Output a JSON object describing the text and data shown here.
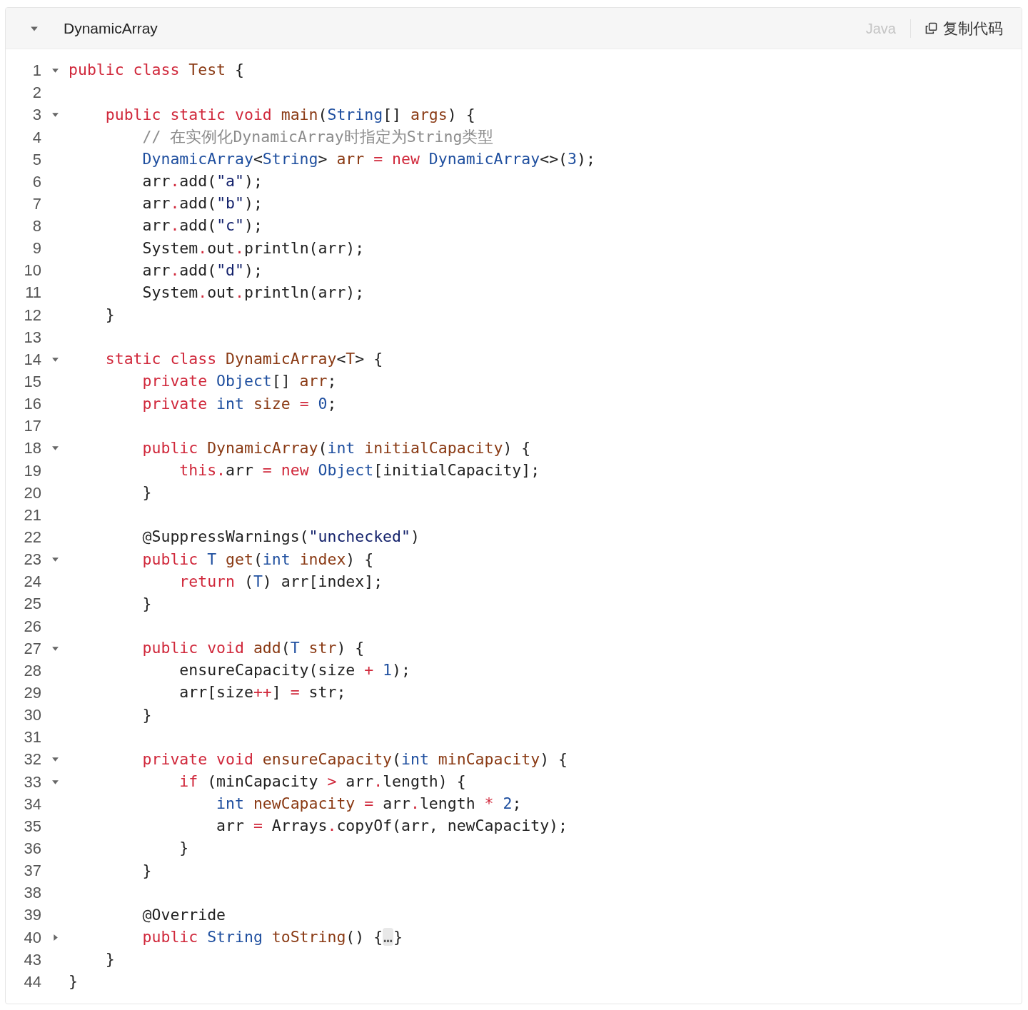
{
  "code_block": {
    "title": "DynamicArray",
    "expanded": true,
    "language": "Java",
    "copy_button": "复制代码",
    "lines": [
      {
        "number": "1",
        "expanded": true,
        "tokens": [
          {
            "kind": "kw",
            "text": "public class"
          },
          {
            "kind": "def",
            "text": " Test"
          },
          {
            "kind": "p",
            "text": " {"
          }
        ]
      },
      {
        "number": "2"
      },
      {
        "number": "3",
        "expanded": true,
        "tokens": [
          {
            "kind": "kw",
            "text": "    public static void"
          },
          {
            "kind": "def",
            "text": " main"
          },
          {
            "kind": "p",
            "text": "("
          },
          {
            "kind": "type",
            "text": "String"
          },
          {
            "kind": "p",
            "text": "[]"
          },
          {
            "kind": "def",
            "text": " args"
          },
          {
            "kind": "p",
            "text": ") {"
          }
        ]
      },
      {
        "number": "4",
        "tokens": [
          {
            "kind": "cm",
            "text": "        // 在实例化DynamicArray时指定为String类型"
          }
        ]
      },
      {
        "number": "5",
        "tokens": [
          {
            "kind": "type",
            "text": "        DynamicArray"
          },
          {
            "kind": "p",
            "text": "<"
          },
          {
            "kind": "type",
            "text": "String"
          },
          {
            "kind": "p",
            "text": ">"
          },
          {
            "kind": "def",
            "text": " arr"
          },
          {
            "kind": "op",
            "text": " ="
          },
          {
            "kind": "kw",
            "text": " new"
          },
          {
            "kind": "type",
            "text": " DynamicArray"
          },
          {
            "kind": "p",
            "text": "<>("
          },
          {
            "kind": "num",
            "text": "3"
          },
          {
            "kind": "p",
            "text": ");"
          }
        ]
      },
      {
        "number": "6",
        "tokens": [
          {
            "kind": "p",
            "text": "        arr"
          },
          {
            "kind": "op",
            "text": "."
          },
          {
            "kind": "p",
            "text": "add("
          },
          {
            "kind": "str",
            "text": "\"a\""
          },
          {
            "kind": "p",
            "text": ");"
          }
        ]
      },
      {
        "number": "7",
        "tokens": [
          {
            "kind": "p",
            "text": "        arr"
          },
          {
            "kind": "op",
            "text": "."
          },
          {
            "kind": "p",
            "text": "add("
          },
          {
            "kind": "str",
            "text": "\"b\""
          },
          {
            "kind": "p",
            "text": ");"
          }
        ]
      },
      {
        "number": "8",
        "tokens": [
          {
            "kind": "p",
            "text": "        arr"
          },
          {
            "kind": "op",
            "text": "."
          },
          {
            "kind": "p",
            "text": "add("
          },
          {
            "kind": "str",
            "text": "\"c\""
          },
          {
            "kind": "p",
            "text": ");"
          }
        ]
      },
      {
        "number": "9",
        "tokens": [
          {
            "kind": "p",
            "text": "        System"
          },
          {
            "kind": "op",
            "text": "."
          },
          {
            "kind": "p",
            "text": "out"
          },
          {
            "kind": "op",
            "text": "."
          },
          {
            "kind": "p",
            "text": "println(arr);"
          }
        ]
      },
      {
        "number": "10",
        "tokens": [
          {
            "kind": "p",
            "text": "        arr"
          },
          {
            "kind": "op",
            "text": "."
          },
          {
            "kind": "p",
            "text": "add("
          },
          {
            "kind": "str",
            "text": "\"d\""
          },
          {
            "kind": "p",
            "text": ");"
          }
        ]
      },
      {
        "number": "11",
        "tokens": [
          {
            "kind": "p",
            "text": "        System"
          },
          {
            "kind": "op",
            "text": "."
          },
          {
            "kind": "p",
            "text": "out"
          },
          {
            "kind": "op",
            "text": "."
          },
          {
            "kind": "p",
            "text": "println(arr);"
          }
        ]
      },
      {
        "number": "12",
        "tokens": [
          {
            "kind": "p",
            "text": "    }"
          }
        ]
      },
      {
        "number": "13"
      },
      {
        "number": "14",
        "expanded": true,
        "tokens": [
          {
            "kind": "kw",
            "text": "    static class"
          },
          {
            "kind": "def",
            "text": " DynamicArray"
          },
          {
            "kind": "p",
            "text": "<"
          },
          {
            "kind": "def",
            "text": "T"
          },
          {
            "kind": "p",
            "text": "> {"
          }
        ]
      },
      {
        "number": "15",
        "tokens": [
          {
            "kind": "kw",
            "text": "        private"
          },
          {
            "kind": "type",
            "text": " Object"
          },
          {
            "kind": "p",
            "text": "[]"
          },
          {
            "kind": "def",
            "text": " arr"
          },
          {
            "kind": "p",
            "text": ";"
          }
        ]
      },
      {
        "number": "16",
        "tokens": [
          {
            "kind": "kw",
            "text": "        private"
          },
          {
            "kind": "type",
            "text": " int"
          },
          {
            "kind": "def",
            "text": " size"
          },
          {
            "kind": "op",
            "text": " ="
          },
          {
            "kind": "num",
            "text": " 0"
          },
          {
            "kind": "p",
            "text": ";"
          }
        ]
      },
      {
        "number": "17"
      },
      {
        "number": "18",
        "expanded": true,
        "tokens": [
          {
            "kind": "kw",
            "text": "        public"
          },
          {
            "kind": "def",
            "text": " DynamicArray"
          },
          {
            "kind": "p",
            "text": "("
          },
          {
            "kind": "type",
            "text": "int"
          },
          {
            "kind": "def",
            "text": " initialCapacity"
          },
          {
            "kind": "p",
            "text": ") {"
          }
        ]
      },
      {
        "number": "19",
        "tokens": [
          {
            "kind": "kw",
            "text": "            this"
          },
          {
            "kind": "op",
            "text": "."
          },
          {
            "kind": "p",
            "text": "arr"
          },
          {
            "kind": "op",
            "text": " ="
          },
          {
            "kind": "kw",
            "text": " new"
          },
          {
            "kind": "type",
            "text": " Object"
          },
          {
            "kind": "p",
            "text": "[initialCapacity];"
          }
        ]
      },
      {
        "number": "20",
        "tokens": [
          {
            "kind": "p",
            "text": "        }"
          }
        ]
      },
      {
        "number": "21"
      },
      {
        "number": "22",
        "tokens": [
          {
            "kind": "p",
            "text": "        @SuppressWarnings("
          },
          {
            "kind": "str",
            "text": "\"unchecked\""
          },
          {
            "kind": "p",
            "text": ")"
          }
        ]
      },
      {
        "number": "23",
        "expanded": true,
        "tokens": [
          {
            "kind": "kw",
            "text": "        public"
          },
          {
            "kind": "type",
            "text": " T"
          },
          {
            "kind": "def",
            "text": " get"
          },
          {
            "kind": "p",
            "text": "("
          },
          {
            "kind": "type",
            "text": "int"
          },
          {
            "kind": "def",
            "text": " index"
          },
          {
            "kind": "p",
            "text": ") {"
          }
        ]
      },
      {
        "number": "24",
        "tokens": [
          {
            "kind": "kw",
            "text": "            return"
          },
          {
            "kind": "p",
            "text": " ("
          },
          {
            "kind": "type",
            "text": "T"
          },
          {
            "kind": "p",
            "text": ") arr[index];"
          }
        ]
      },
      {
        "number": "25",
        "tokens": [
          {
            "kind": "p",
            "text": "        }"
          }
        ]
      },
      {
        "number": "26"
      },
      {
        "number": "27",
        "expanded": true,
        "tokens": [
          {
            "kind": "kw",
            "text": "        public void"
          },
          {
            "kind": "def",
            "text": " add"
          },
          {
            "kind": "p",
            "text": "("
          },
          {
            "kind": "type",
            "text": "T"
          },
          {
            "kind": "def",
            "text": " str"
          },
          {
            "kind": "p",
            "text": ") {"
          }
        ]
      },
      {
        "number": "28",
        "tokens": [
          {
            "kind": "p",
            "text": "            ensureCapacity(size"
          },
          {
            "kind": "op",
            "text": " +"
          },
          {
            "kind": "num",
            "text": " 1"
          },
          {
            "kind": "p",
            "text": ");"
          }
        ]
      },
      {
        "number": "29",
        "tokens": [
          {
            "kind": "p",
            "text": "            arr[size"
          },
          {
            "kind": "op",
            "text": "++"
          },
          {
            "kind": "p",
            "text": "]"
          },
          {
            "kind": "op",
            "text": " ="
          },
          {
            "kind": "p",
            "text": " str;"
          }
        ]
      },
      {
        "number": "30",
        "tokens": [
          {
            "kind": "p",
            "text": "        }"
          }
        ]
      },
      {
        "number": "31"
      },
      {
        "number": "32",
        "expanded": true,
        "tokens": [
          {
            "kind": "kw",
            "text": "        private void"
          },
          {
            "kind": "def",
            "text": " ensureCapacity"
          },
          {
            "kind": "p",
            "text": "("
          },
          {
            "kind": "type",
            "text": "int"
          },
          {
            "kind": "def",
            "text": " minCapacity"
          },
          {
            "kind": "p",
            "text": ") {"
          }
        ]
      },
      {
        "number": "33",
        "expanded": true,
        "tokens": [
          {
            "kind": "kw",
            "text": "            if"
          },
          {
            "kind": "p",
            "text": " (minCapacity"
          },
          {
            "kind": "op",
            "text": " >"
          },
          {
            "kind": "p",
            "text": " arr"
          },
          {
            "kind": "op",
            "text": "."
          },
          {
            "kind": "p",
            "text": "length) {"
          }
        ]
      },
      {
        "number": "34",
        "tokens": [
          {
            "kind": "type",
            "text": "                int"
          },
          {
            "kind": "def",
            "text": " newCapacity"
          },
          {
            "kind": "op",
            "text": " ="
          },
          {
            "kind": "p",
            "text": " arr"
          },
          {
            "kind": "op",
            "text": "."
          },
          {
            "kind": "p",
            "text": "length"
          },
          {
            "kind": "op",
            "text": " *"
          },
          {
            "kind": "num",
            "text": " 2"
          },
          {
            "kind": "p",
            "text": ";"
          }
        ]
      },
      {
        "number": "35",
        "tokens": [
          {
            "kind": "p",
            "text": "                arr"
          },
          {
            "kind": "op",
            "text": " ="
          },
          {
            "kind": "p",
            "text": " Arrays"
          },
          {
            "kind": "op",
            "text": "."
          },
          {
            "kind": "p",
            "text": "copyOf(arr, newCapacity);"
          }
        ]
      },
      {
        "number": "36",
        "tokens": [
          {
            "kind": "p",
            "text": "            }"
          }
        ]
      },
      {
        "number": "37",
        "tokens": [
          {
            "kind": "p",
            "text": "        }"
          }
        ]
      },
      {
        "number": "38"
      },
      {
        "number": "39",
        "tokens": [
          {
            "kind": "p",
            "text": "        @Override"
          }
        ]
      },
      {
        "number": "40",
        "expanded": false,
        "tokens": [
          {
            "kind": "kw",
            "text": "        public"
          },
          {
            "kind": "type",
            "text": " String"
          },
          {
            "kind": "def",
            "text": " toString"
          },
          {
            "kind": "p",
            "text": "() {"
          },
          {
            "kind": "fold",
            "text": "…"
          },
          {
            "kind": "p",
            "text": "}"
          }
        ]
      },
      {
        "number": "43",
        "tokens": [
          {
            "kind": "p",
            "text": "    }"
          }
        ]
      },
      {
        "number": "44",
        "tokens": [
          {
            "kind": "p",
            "text": "}"
          }
        ]
      }
    ]
  }
}
